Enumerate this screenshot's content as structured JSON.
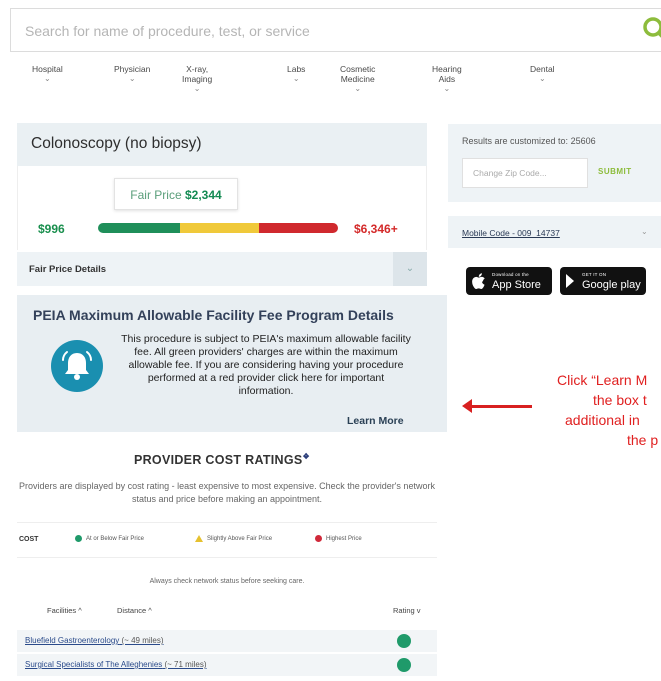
{
  "search": {
    "placeholder": "Search for name of procedure, test, or service",
    "icon": "search-icon"
  },
  "nav": [
    {
      "label": "Hospital"
    },
    {
      "label": "Physician"
    },
    {
      "label": "X-ray, Imaging"
    },
    {
      "label": "Labs"
    },
    {
      "label": "Cosmetic Medicine"
    },
    {
      "label": "Hearing Aids"
    },
    {
      "label": "Dental"
    }
  ],
  "procedure": {
    "title": "Colonoscopy (no biopsy)",
    "fair_price_label": "Fair Price",
    "fair_price_value": "$2,344",
    "low_price": "$996",
    "high_price": "$6,346+",
    "price_bar": [
      {
        "color": "#1f8f5a",
        "fraction": 0.34
      },
      {
        "color": "#f0c93a",
        "fraction": 0.33
      },
      {
        "color": "#d0292e",
        "fraction": 0.33
      }
    ],
    "details_label": "Fair Price Details"
  },
  "peia": {
    "title": "PEIA Maximum Allowable Facility Fee Program Details",
    "body": "This procedure is subject to PEIA's maximum allowable facility fee.  All green providers' charges are within the maximum allowable fee.  If you are considering having your procedure performed at a red provider click here for important information.",
    "learn_more": "Learn More"
  },
  "provider_ratings": {
    "title": "PROVIDER COST RATINGS",
    "description": "Providers are displayed by cost rating - least expensive to most expensive. Check the provider's network status and price before making an appointment.",
    "legend_label": "COST",
    "legend": [
      {
        "label": "At or Below Fair Price",
        "color": "#1f9a6a"
      },
      {
        "label": "Slightly Above Fair Price",
        "color": "#e6c12f"
      },
      {
        "label": "Highest Price",
        "color": "#d0293a"
      }
    ],
    "notice": "Always check network status before seeking care.",
    "sort": {
      "facilities": "Facilities ^",
      "distance": "Distance ^",
      "rating": "Rating v"
    },
    "providers": [
      {
        "name": "Bluefield Gastroenterology",
        "distance": "(~ 49 miles)",
        "rating_color": "#1f9a6a"
      },
      {
        "name": "Surgical Specialists of The Alleghenies",
        "distance": "(~ 71 miles)",
        "rating_color": "#1f9a6a"
      }
    ]
  },
  "sidebar": {
    "results_label": "Results are customized to:",
    "zip": "25606",
    "zip_placeholder": "Change Zip Code...",
    "submit": "SUBMIT",
    "mobile_code": "Mobile Code - 009_14737",
    "app_store": {
      "small": "Download on the",
      "big": "App Store"
    },
    "google_play": {
      "small": "GET IT ON",
      "big": "Google play"
    }
  },
  "annotation": {
    "lines": [
      "Click “Learn M",
      "the box t",
      "additional in",
      "the p"
    ],
    "color": "#e02020"
  }
}
